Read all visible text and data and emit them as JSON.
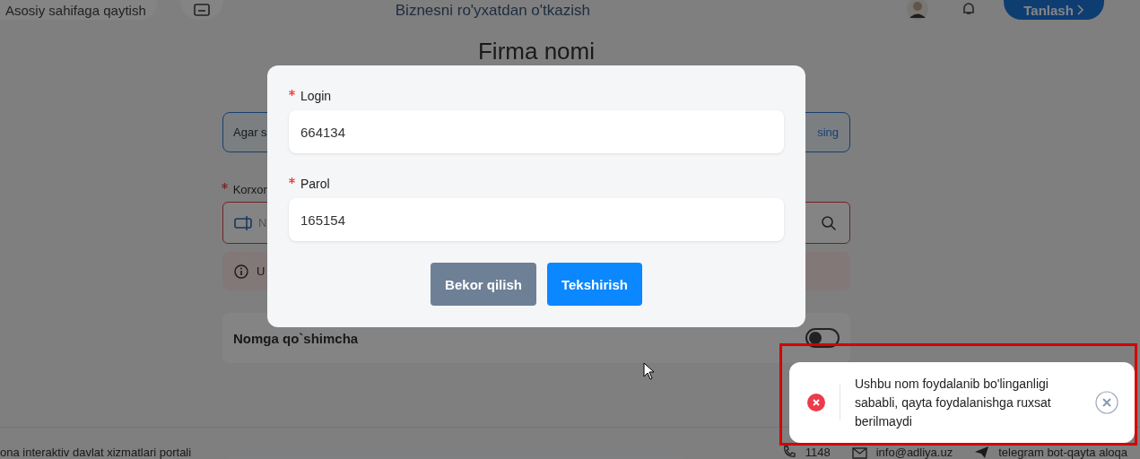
{
  "header": {
    "back_button": "Asosiy sahifaga qaytish",
    "title": "Biznesni ro'yxatdan o'tkazish",
    "select_button": "Tanlash"
  },
  "page": {
    "title": "Firma nomi",
    "notice_start": "Agar s",
    "notice_end": "sing",
    "field_required": true,
    "field_label": "Korxon",
    "field_placeholder": "N",
    "error_start": "U",
    "suffix_label": "Nomga qo`shimcha",
    "suffix_on": false
  },
  "footer": {
    "portal": "ona interaktiv davlat xizmatlari portali",
    "phone": "1148",
    "email": "info@adliya.uz",
    "telegram": "telegram bot-qayta aloqa"
  },
  "modal": {
    "fields": [
      {
        "label": "Login",
        "value": "664134",
        "required": true
      },
      {
        "label": "Parol",
        "value": "165154",
        "required": true
      }
    ],
    "buttons": [
      {
        "label": "Bekor qilish",
        "kind": "secondary"
      },
      {
        "label": "Tekshirish",
        "kind": "primary"
      }
    ]
  },
  "toast": {
    "kind": "error",
    "message": "Ushbu nom foydalanib bo'linganligi sababli, qayta foydalanishga ruxsat berilmaydi"
  }
}
